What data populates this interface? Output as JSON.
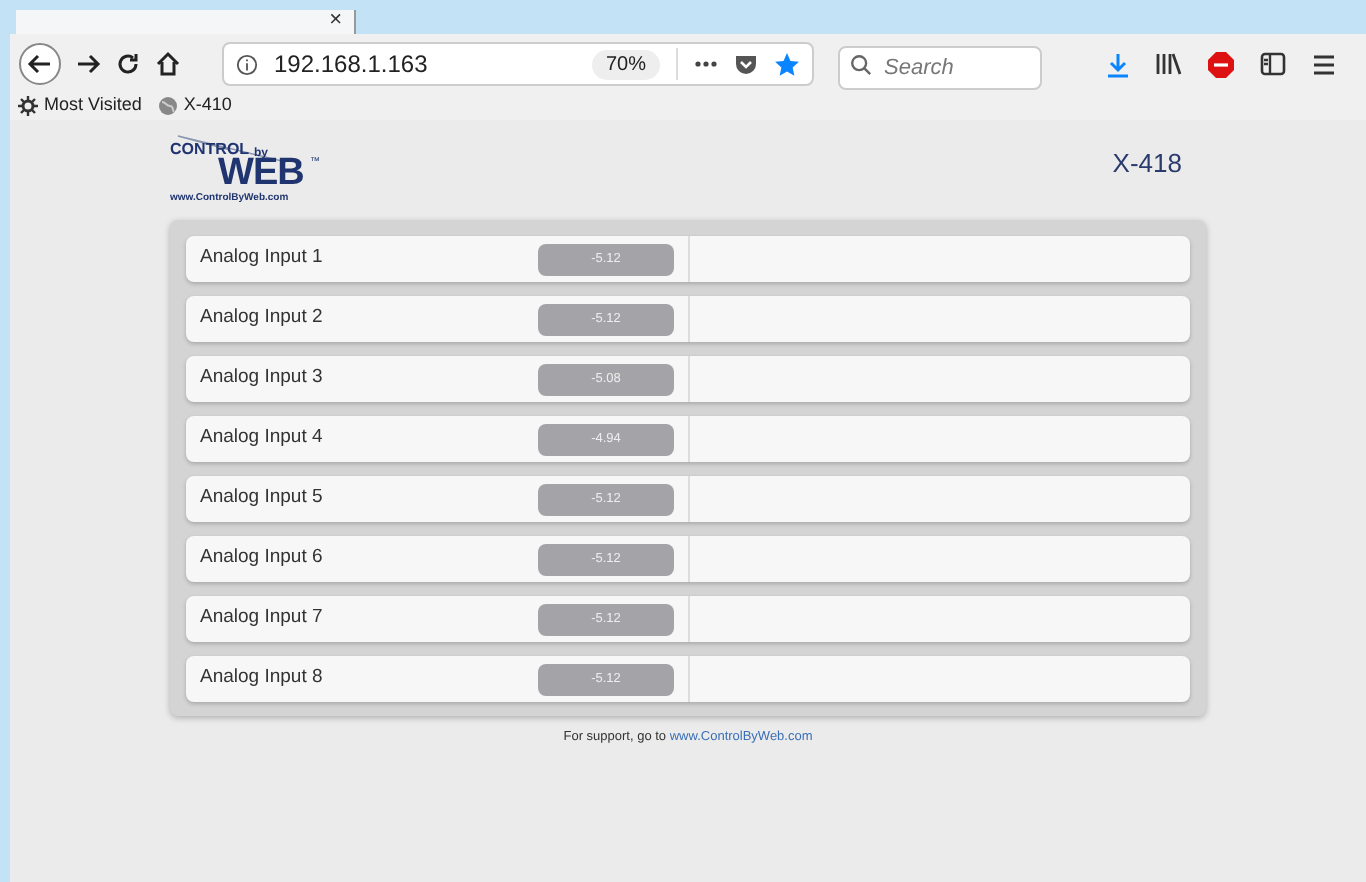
{
  "browser": {
    "tab_close": "×",
    "url": "192.168.1.163",
    "zoom": "70%",
    "search": {
      "placeholder": "Search"
    },
    "bookmarks": [
      {
        "label": "Most Visited",
        "kind": "gear"
      },
      {
        "label": "X-410",
        "kind": "globe"
      }
    ]
  },
  "header": {
    "logo": {
      "top": "CONTROL",
      "by": "by",
      "main": "WEB",
      "tm": "™",
      "url": "www.ControlByWeb.com"
    },
    "device": "X-418"
  },
  "inputs": [
    {
      "name": "Analog Input 1",
      "value": "-5.12"
    },
    {
      "name": "Analog Input 2",
      "value": "-5.12"
    },
    {
      "name": "Analog Input 3",
      "value": "-5.08"
    },
    {
      "name": "Analog Input 4",
      "value": "-4.94"
    },
    {
      "name": "Analog Input 5",
      "value": "-5.12"
    },
    {
      "name": "Analog Input 6",
      "value": "-5.12"
    },
    {
      "name": "Analog Input 7",
      "value": "-5.12"
    },
    {
      "name": "Analog Input 8",
      "value": "-5.12"
    }
  ],
  "footer": {
    "text": "For support, go to",
    "link": "www.ControlByWeb.com"
  }
}
